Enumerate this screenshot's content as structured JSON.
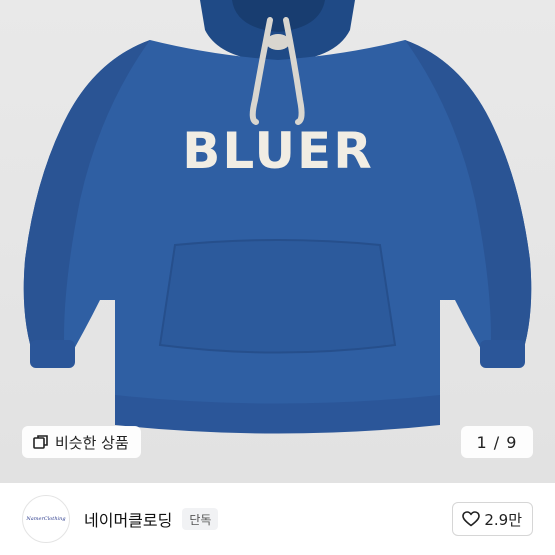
{
  "product": {
    "image_alt_print": "BLUER",
    "similar_button_label": "비슷한 상품",
    "page_counter": "1 / 9",
    "colors": {
      "hoodie": "#2f5fa3",
      "background": "#e6e6e6",
      "print": "#f1ede4"
    }
  },
  "shop": {
    "avatar_text": "NamerClothing",
    "name": "네이머클로딩",
    "badge": "단독",
    "like_count": "2.9만"
  },
  "icons": {
    "similar": "stacked-squares-icon",
    "like": "heart-outline-icon"
  }
}
